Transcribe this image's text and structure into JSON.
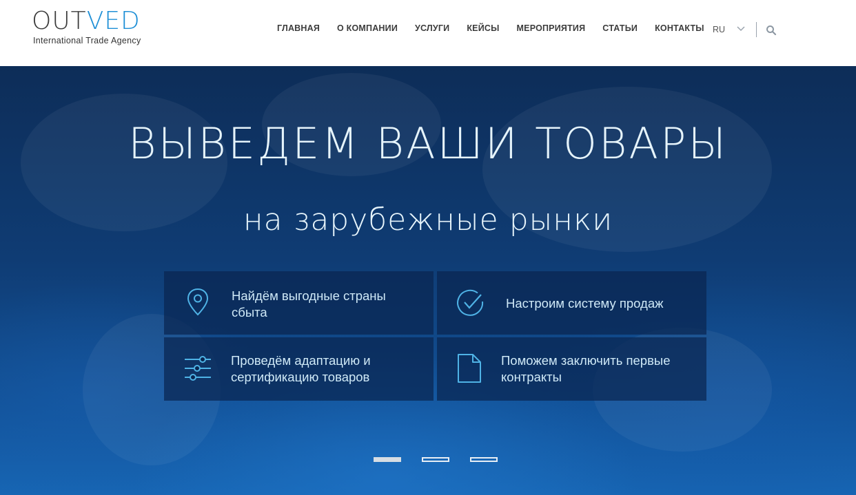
{
  "header": {
    "logo": {
      "text_main": "OUT",
      "text_accent": "VED",
      "tagline": "International Trade Agency"
    },
    "nav": [
      {
        "label": "ГЛАВНАЯ"
      },
      {
        "label": "О КОМПАНИИ"
      },
      {
        "label": "УСЛУГИ"
      },
      {
        "label": "КЕЙСЫ"
      },
      {
        "label": "МЕРОПРИЯТИЯ"
      },
      {
        "label": "СТАТЬИ"
      },
      {
        "label": "КОНТАКТЫ"
      }
    ],
    "language": "RU",
    "icons": {
      "lang": "chevron-down-icon",
      "search": "search-icon"
    }
  },
  "hero": {
    "title": "ВЫВЕДЕМ ВАШИ ТОВАРЫ",
    "subtitle": "на зарубежные рынки",
    "features": [
      {
        "icon": "location-pin-icon",
        "line1": "Найдём выгодные страны",
        "line2": "сбыта"
      },
      {
        "icon": "check-circle-icon",
        "line1": "Настроим систему продаж",
        "line2": ""
      },
      {
        "icon": "sliders-icon",
        "line1": "Проведём адаптацию и",
        "line2": "сертификацию товаров"
      },
      {
        "icon": "document-icon",
        "line1": "Поможем заключить первые",
        "line2": "контракты"
      }
    ],
    "slider": {
      "total": 3,
      "active_index": 0
    }
  },
  "colors": {
    "accent": "#1e8fd6",
    "hero_dark": "#0d2d58",
    "hero_light": "#1766b4",
    "card_text": "#cfe9f7",
    "icon": "#4fb3e6"
  }
}
